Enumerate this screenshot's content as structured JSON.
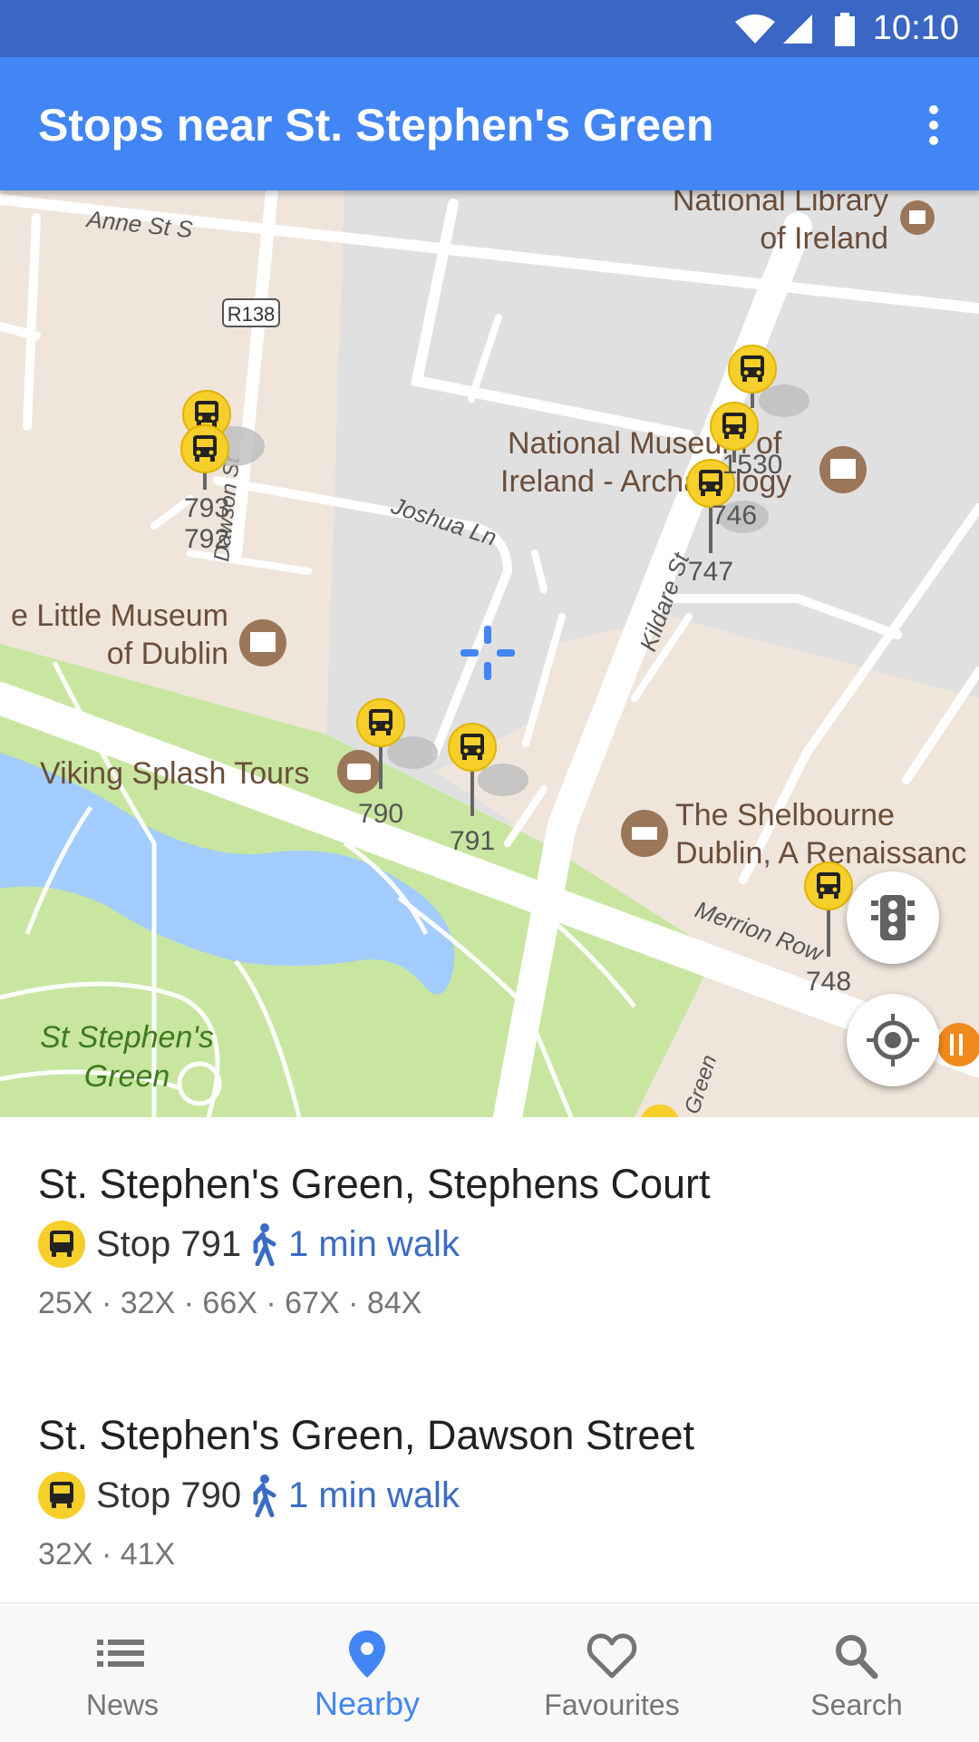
{
  "status_bar": {
    "time": "10:10"
  },
  "app_bar": {
    "title": "Stops near St. Stephen's Green"
  },
  "map": {
    "streets": [
      "Anne St S",
      "R138",
      "Dawson St",
      "Joshua Ln",
      "Kildare St",
      "Merrion Row",
      "Green"
    ],
    "places": [
      {
        "name": "National Library of Ireland",
        "lines": [
          "National Library",
          "of Ireland"
        ]
      },
      {
        "name": "National Museum of Ireland - Archaeology",
        "lines": [
          "National Museum of",
          "Ireland - Archaeology"
        ]
      },
      {
        "name": "Little Museum of Dublin",
        "lines": [
          "e Little Museum",
          "of Dublin"
        ]
      },
      {
        "name": "Viking Splash Tours",
        "lines": [
          "Viking Splash Tours"
        ]
      },
      {
        "name": "The Shelbourne Dublin, A Renaissance",
        "lines": [
          "The Shelbourne",
          "Dublin, A Renaissanc"
        ]
      },
      {
        "name": "St Stephen's Green",
        "lines": [
          "St Stephen's",
          "Green"
        ]
      }
    ],
    "stops": [
      "793",
      "792",
      "1530",
      "746",
      "747",
      "790",
      "791",
      "748"
    ]
  },
  "stops": [
    {
      "name": "St. Stephen's Green, Stephens Court",
      "stop": "Stop 791",
      "walk": "1 min walk",
      "routes": "25X · 32X · 66X · 67X · 84X"
    },
    {
      "name": "St. Stephen's Green, Dawson Street",
      "stop": "Stop 790",
      "walk": "1 min walk",
      "routes": "32X · 41X"
    }
  ],
  "nav": [
    {
      "label": "News",
      "icon": "list-icon",
      "active": false
    },
    {
      "label": "Nearby",
      "icon": "location-pin-icon",
      "active": true
    },
    {
      "label": "Favourites",
      "icon": "heart-icon",
      "active": false
    },
    {
      "label": "Search",
      "icon": "search-icon",
      "active": false
    }
  ],
  "colors": {
    "status_bar": "#3a67c4",
    "app_bar": "#4285f4",
    "park": "#c8e6a0",
    "water": "#a3ccff",
    "bus_stop": "#f7cf2a",
    "active_nav": "#4285f4",
    "walk_text": "#3a6cc4"
  }
}
